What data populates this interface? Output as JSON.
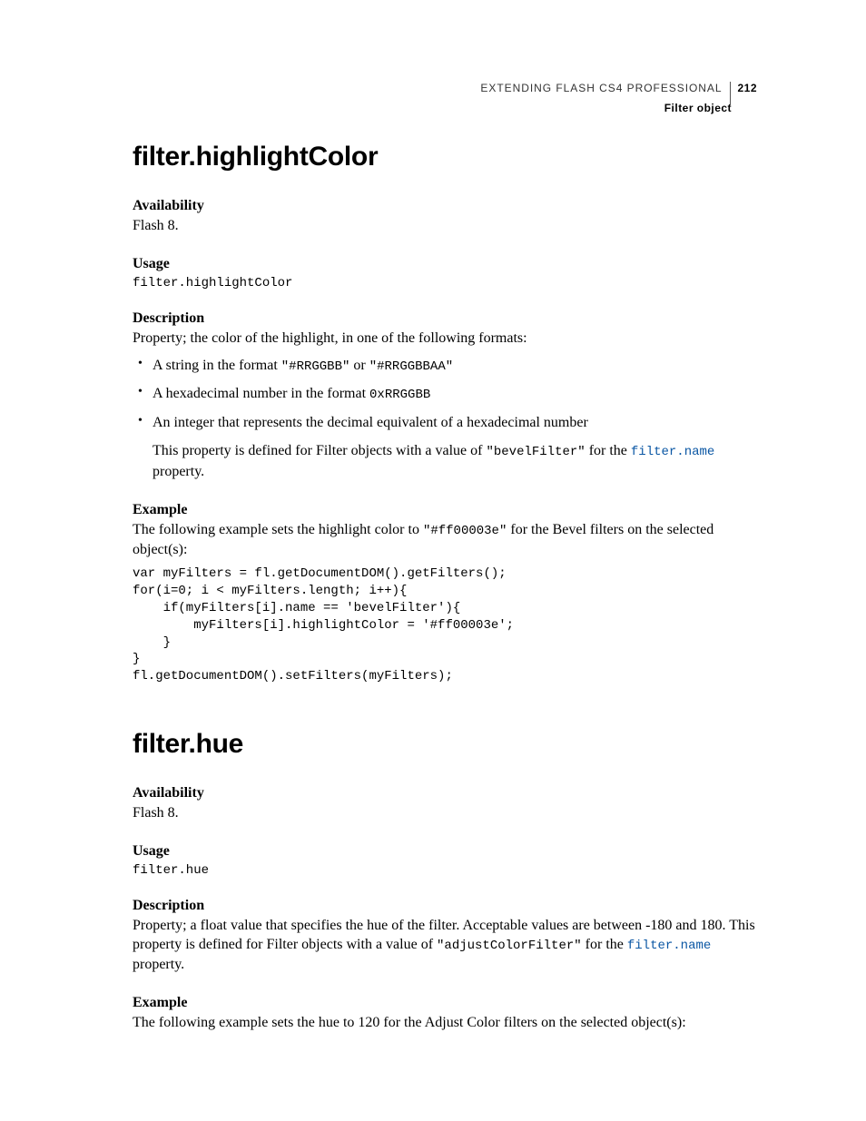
{
  "runhead": {
    "doc_title": "EXTENDING FLASH CS4 PROFESSIONAL",
    "page_number": "212",
    "section": "Filter object"
  },
  "s1": {
    "title": "filter.highlightColor",
    "availability_h": "Availability",
    "availability_v": "Flash 8.",
    "usage_h": "Usage",
    "usage_code": "filter.highlightColor",
    "description_h": "Description",
    "description_intro": "Property; the color of the highlight, in one of the following formats:",
    "b1_pre": "A string in the format ",
    "b1_code1": "\"#RRGGBB\"",
    "b1_mid": " or ",
    "b1_code2": "\"#RRGGBBAA\"",
    "b2_pre": "A hexadecimal number in the format ",
    "b2_code": "0xRRGGBB",
    "b3": "An integer that represents the decimal equivalent of a hexadecimal number",
    "note_pre": "This property is defined for Filter objects with a value of ",
    "note_code": "\"bevelFilter\"",
    "note_mid": " for the ",
    "note_link": "filter.name",
    "note_post": " property.",
    "example_h": "Example",
    "example_intro_pre": "The following example sets the highlight color to ",
    "example_intro_code": "\"#ff00003e\"",
    "example_intro_post": " for the Bevel filters on the selected object(s):",
    "example_code": "var myFilters = fl.getDocumentDOM().getFilters();\nfor(i=0; i < myFilters.length; i++){\n    if(myFilters[i].name == 'bevelFilter'){\n        myFilters[i].highlightColor = '#ff00003e';\n    }\n}\nfl.getDocumentDOM().setFilters(myFilters);"
  },
  "s2": {
    "title": "filter.hue",
    "availability_h": "Availability",
    "availability_v": "Flash 8.",
    "usage_h": "Usage",
    "usage_code": "filter.hue",
    "description_h": "Description",
    "desc_pre": "Property; a float value that specifies the hue of the filter. Acceptable values are between -180 and 180. This property is defined for Filter objects with a value of ",
    "desc_code": "\"adjustColorFilter\"",
    "desc_mid": " for the ",
    "desc_link": "filter.name",
    "desc_post": " property.",
    "example_h": "Example",
    "example_intro": "The following example sets the hue to 120 for the Adjust Color filters on the selected object(s):"
  }
}
